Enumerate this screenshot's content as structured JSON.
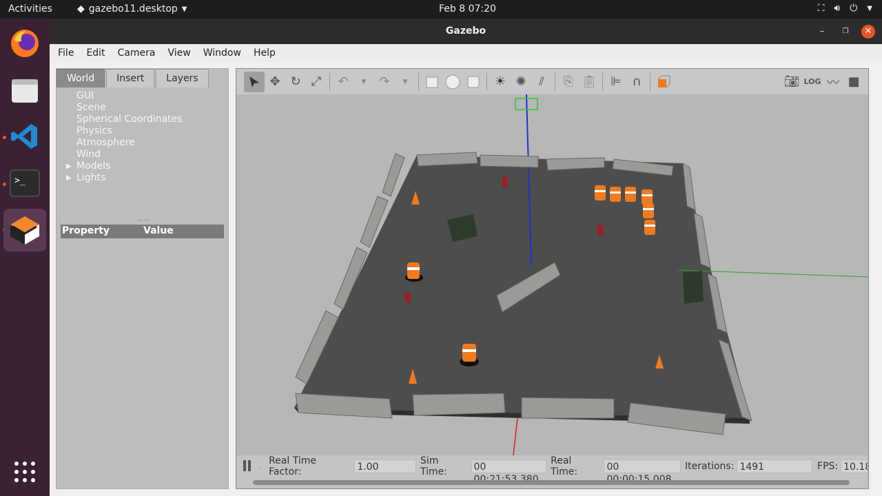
{
  "topbar": {
    "activities": "Activities",
    "app_name": "gazebo11.desktop",
    "clock": "Feb 8  07:20"
  },
  "window": {
    "title": "Gazebo"
  },
  "menu": {
    "file": "File",
    "edit": "Edit",
    "camera": "Camera",
    "view": "View",
    "window": "Window",
    "help": "Help"
  },
  "left_panel": {
    "tabs": {
      "world": "World",
      "insert": "Insert",
      "layers": "Layers"
    },
    "tree": {
      "gui": "GUI",
      "scene": "Scene",
      "spherical": "Spherical Coordinates",
      "physics": "Physics",
      "atmosphere": "Atmosphere",
      "wind": "Wind",
      "models": "Models",
      "lights": "Lights"
    },
    "property_header": {
      "property": "Property",
      "value": "Value"
    }
  },
  "status": {
    "rtf_label": "Real Time Factor:",
    "rtf_value": "1.00",
    "sim_label": "Sim Time:",
    "sim_value": "00 00:21:53.380",
    "real_label": "Real Time:",
    "real_value": "00 00:00:15.008",
    "iter_label": "Iterations:",
    "iter_value": "1491",
    "fps_label": "FPS:",
    "fps_value": "10.18"
  },
  "colors": {
    "accent": "#e95420",
    "dock_bg": "#3a2234",
    "ground": "#4a4a4a"
  }
}
